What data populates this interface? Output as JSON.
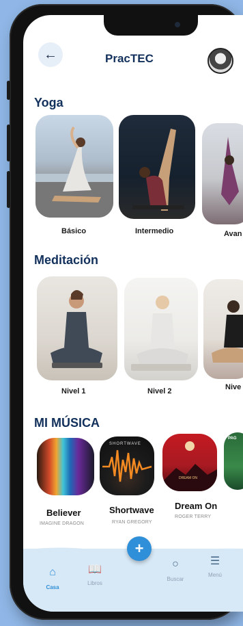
{
  "header": {
    "title": "PracTEC",
    "back_icon": "arrow-left-icon",
    "avatar": "user-avatar"
  },
  "yoga": {
    "title": "Yoga",
    "items": [
      {
        "label": "Básico"
      },
      {
        "label": "Intermedio"
      },
      {
        "label": "Avan"
      }
    ]
  },
  "meditation": {
    "title": "Meditación",
    "items": [
      {
        "label": "Nivel 1"
      },
      {
        "label": "Nivel 2"
      },
      {
        "label": "Nive"
      }
    ]
  },
  "music": {
    "title": "MI MÚSICA",
    "items": [
      {
        "title": "Believer",
        "artist": "IMAGINE DRAGON",
        "cover_label": ""
      },
      {
        "title": "Shortwave",
        "artist": "RYAN GREGORY",
        "cover_label": "SHORTWAVE"
      },
      {
        "title": "Dream On",
        "artist": "ROGER TERRY",
        "cover_label": "DREAM ON"
      },
      {
        "title": "",
        "artist": "",
        "cover_label": "PAG"
      }
    ]
  },
  "fab": {
    "label": "+"
  },
  "nav": {
    "items": [
      {
        "label": "Casa",
        "icon": "home-icon",
        "active": true
      },
      {
        "label": "Libros",
        "icon": "book-icon",
        "active": false
      },
      {
        "label": "Buscar",
        "icon": "search-icon",
        "active": false
      },
      {
        "label": "Menú",
        "icon": "menu-icon",
        "active": false
      }
    ]
  },
  "colors": {
    "accent": "#2f8fd8",
    "title": "#12305c",
    "navbar": "#d7e8f6",
    "background": "#8fb6e6"
  }
}
